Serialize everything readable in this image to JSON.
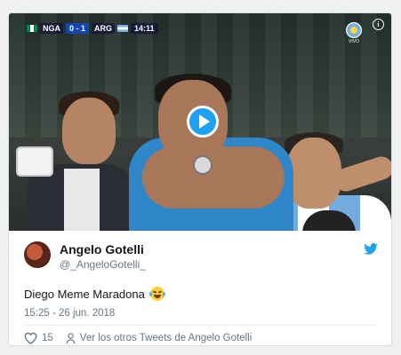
{
  "video": {
    "scorebug": {
      "team_home": "NGA",
      "score": "0 - 1",
      "team_away": "ARG",
      "clock": "14:11"
    },
    "broadcaster_label": "VIVO",
    "info_label": "i",
    "play_icon": "play-icon"
  },
  "tweet": {
    "display_name": "Angelo Gotelli",
    "handle": "@_AngeloGotelli_",
    "text": "Diego Meme Maradona",
    "emoji": "face-with-tears-of-joy",
    "timestamp": "15:25 - 26 jun. 2018",
    "likes": "15",
    "more_link": "Ver los otros Tweets de Angelo Gotelli"
  },
  "colors": {
    "accent": "#1da1f2",
    "text_primary": "#14171a",
    "text_secondary": "#657786"
  },
  "icons": {
    "brand": "twitter-bird-icon",
    "like": "heart-icon",
    "profile": "person-icon"
  }
}
